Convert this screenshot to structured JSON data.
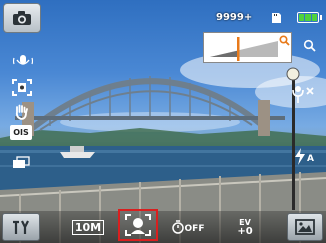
{
  "top_bar": {
    "mode_icon": "camera-icon",
    "shots_remaining": "9999+",
    "storage_icon": "memory-card-icon",
    "battery_level": 1.0,
    "battery_color": "#4fd23c"
  },
  "zoom": {
    "level": 0.45,
    "icons": [
      "zoom-search-icon",
      "zoom-magnifier-icon"
    ],
    "marker_color": "#e87a1a"
  },
  "left_sidebar": {
    "icons": [
      "audio-record-icon",
      "face-frame-icon",
      "hand-icon",
      "ois-icon",
      "drive-mode-icon"
    ],
    "ois_label": "OIS"
  },
  "right_sidebar": {
    "icons": [
      "macro-icon",
      "flash-auto-icon"
    ],
    "flash_label": "A"
  },
  "bottom_bar": {
    "settings_icon": "settings-icon",
    "resolution_label": "10M",
    "face_detect_icon": "face-detection-icon",
    "self_timer_label": "OFF",
    "ev_label": "EV",
    "ev_value": "+0",
    "scene_icon": "scene-menu-icon",
    "highlight_color": "#d91f1f"
  }
}
